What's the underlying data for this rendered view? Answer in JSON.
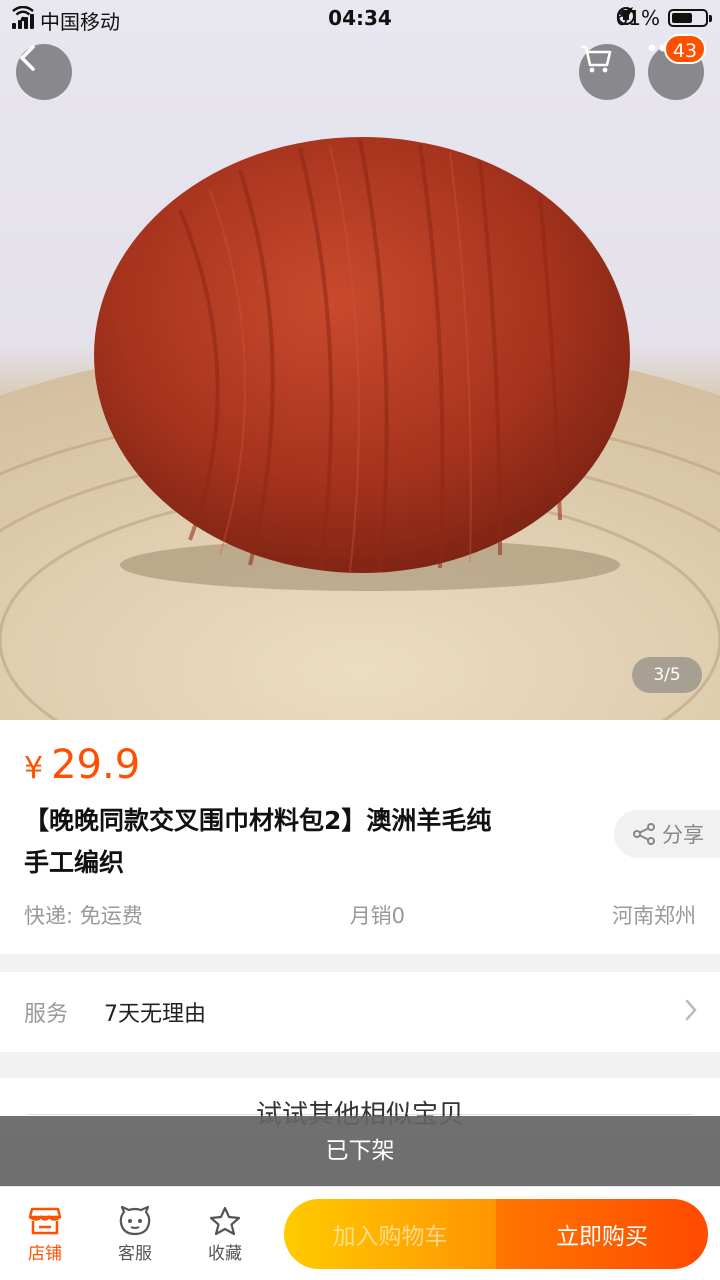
{
  "status_bar": {
    "carrier": "中国移动",
    "time": "04:34",
    "battery_percent_text": "61%",
    "battery_level": 0.61
  },
  "header": {
    "cart_badge": "43"
  },
  "gallery": {
    "pager": "3/5"
  },
  "product": {
    "currency": "¥",
    "price": "29.9",
    "title_line1": "【晚晚同款交叉围巾材料包2】澳洲羊毛纯",
    "title_line2": "手工编织",
    "share_label": "分享",
    "shipping": "快递: 免运费",
    "monthly_sales": "月销0",
    "location": "河南郑州"
  },
  "service": {
    "label": "服务",
    "value": "7天无理由"
  },
  "similar": {
    "heading": "试试其他相似宝贝"
  },
  "notice": {
    "off_shelf": "已下架"
  },
  "bottom_bar": {
    "shop_label": "店铺",
    "support_label": "客服",
    "favorite_label": "收藏",
    "add_to_cart_label": "加入购物车",
    "buy_now_label": "立即购买"
  },
  "colors": {
    "accent": "#ff5000",
    "yarn": "#b5371f"
  }
}
